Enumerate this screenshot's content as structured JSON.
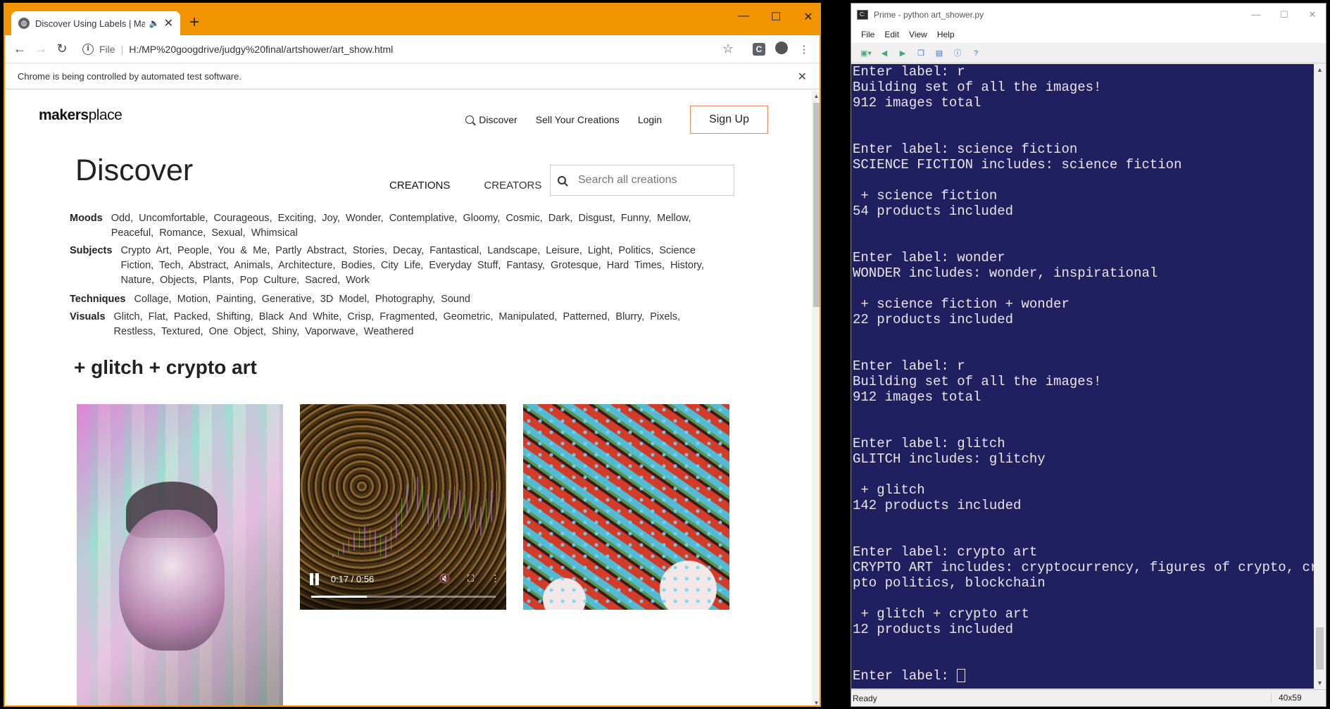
{
  "chrome": {
    "tab_title": "Discover Using Labels | Mak",
    "favicon": "globe-icon",
    "url_label": "File",
    "url": "H:/MP%20googdrive/judgy%20final/artshower/art_show.html",
    "infobar": "Chrome is being controlled by automated test software."
  },
  "site": {
    "logo_bold": "makers",
    "logo_rest": "place",
    "nav": {
      "discover": "Discover",
      "sell": "Sell Your Creations",
      "login": "Login",
      "signup": "Sign Up"
    },
    "title": "Discover",
    "tabs": [
      "CREATIONS",
      "CREATORS"
    ],
    "search_placeholder": "Search all creations",
    "facets": {
      "moods_label": "Moods",
      "moods": "Odd, Uncomfortable, Courageous, Exciting, Joy, Wonder, Contemplative, Gloomy, Cosmic, Dark, Disgust, Funny, Mellow, Peaceful, Romance, Sexual, Whimsical",
      "subjects_label": "Subjects",
      "subjects": "Crypto Art, People, You & Me, Partly Abstract, Stories, Decay, Fantastical, Landscape, Leisure, Light, Politics, Science Fiction, Tech, Abstract, Animals, Architecture, Bodies, City Life, Everyday Stuff, Fantasy, Grotesque, Hard Times, History, Nature, Objects, Plants, Pop Culture, Sacred, Work",
      "techniques_label": "Techniques",
      "techniques": "Collage, Motion, Painting, Generative, 3D Model, Photography, Sound",
      "visuals_label": "Visuals",
      "visuals": "Glitch, Flat, Packed, Shifting, Black And White, Crisp, Fragmented, Geometric, Manipulated, Patterned, Blurry, Pixels, Restless, Textured, One Object, Shiny, Vaporwave, Weathered"
    },
    "filter_heading": "+ glitch + crypto art",
    "video": {
      "time": "0:17 / 0:56",
      "progress": 0.3
    }
  },
  "console": {
    "title": "Prime - python  art_shower.py",
    "menu": [
      "File",
      "Edit",
      "View",
      "Help"
    ],
    "lines": [
      "Enter label: r",
      "Building set of all the images!",
      "912 images total",
      "",
      "",
      "Enter label: science fiction",
      "SCIENCE FICTION includes: science fiction",
      "",
      " + science fiction",
      "54 products included",
      "",
      "",
      "Enter label: wonder",
      "WONDER includes: wonder, inspirational",
      "",
      " + science fiction + wonder",
      "22 products included",
      "",
      "",
      "Enter label: r",
      "Building set of all the images!",
      "912 images total",
      "",
      "",
      "Enter label: glitch",
      "GLITCH includes: glitchy",
      "",
      " + glitch",
      "142 products included",
      "",
      "",
      "Enter label: crypto art",
      "CRYPTO ART includes: cryptocurrency, figures of crypto, cry",
      "pto politics, blockchain",
      "",
      " + glitch + crypto art",
      "12 products included",
      "",
      ""
    ],
    "prompt": "Enter label: ",
    "status": "Ready",
    "dims": "40x59"
  }
}
